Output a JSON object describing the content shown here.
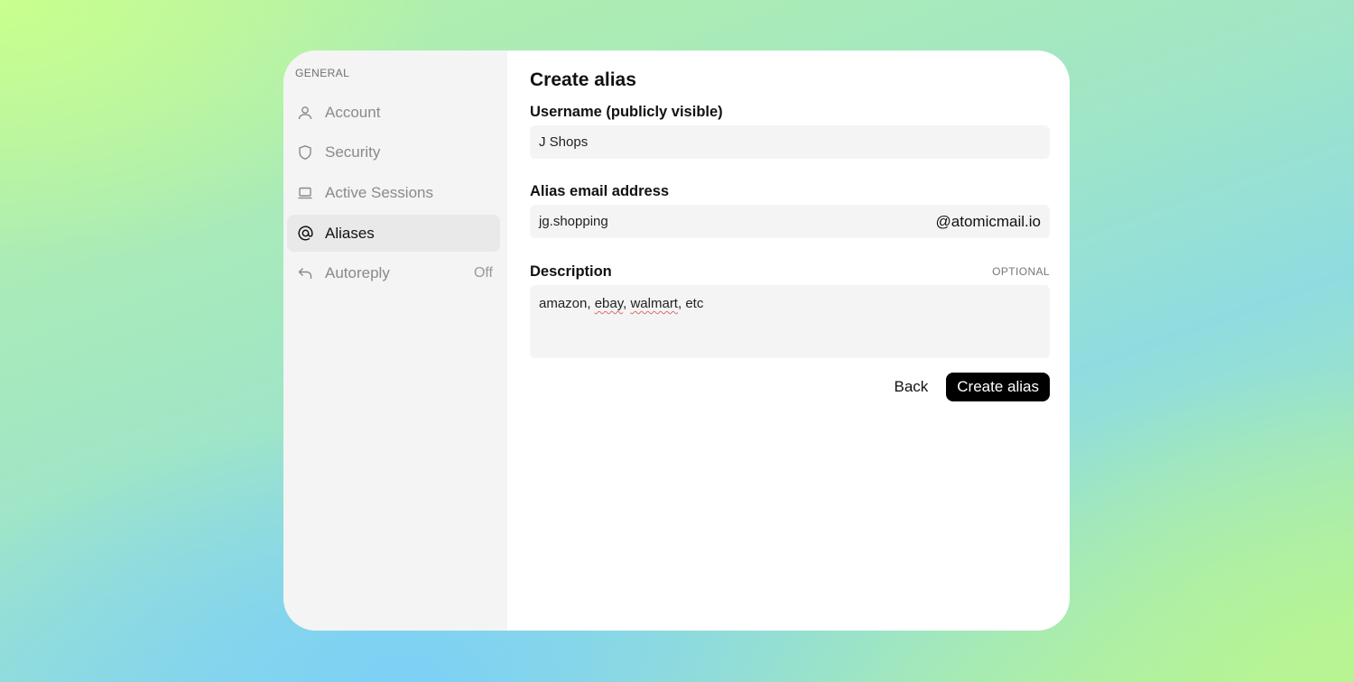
{
  "sidebar": {
    "heading": "GENERAL",
    "items": [
      {
        "label": "Account",
        "icon": "user-icon",
        "trail": ""
      },
      {
        "label": "Security",
        "icon": "shield-icon",
        "trail": ""
      },
      {
        "label": "Active Sessions",
        "icon": "laptop-icon",
        "trail": ""
      },
      {
        "label": "Aliases",
        "icon": "at-icon",
        "trail": "",
        "active": true
      },
      {
        "label": "Autoreply",
        "icon": "reply-icon",
        "trail": "Off"
      }
    ]
  },
  "main": {
    "title": "Create alias",
    "username": {
      "label": "Username (publicly visible)",
      "value": "J Shops"
    },
    "alias": {
      "label": "Alias email address",
      "value": "jg.shopping",
      "suffix": "@atomicmail.io"
    },
    "description": {
      "label": "Description",
      "optional": "OPTIONAL",
      "value_parts": [
        "amazon, ",
        "ebay",
        ", ",
        "walmart",
        ", etc"
      ]
    },
    "back_label": "Back",
    "create_label": "Create alias"
  },
  "colors": {
    "primary_button": "#000000",
    "sidebar_bg": "#f4f4f4",
    "active_item_bg": "#e9e9e9"
  }
}
